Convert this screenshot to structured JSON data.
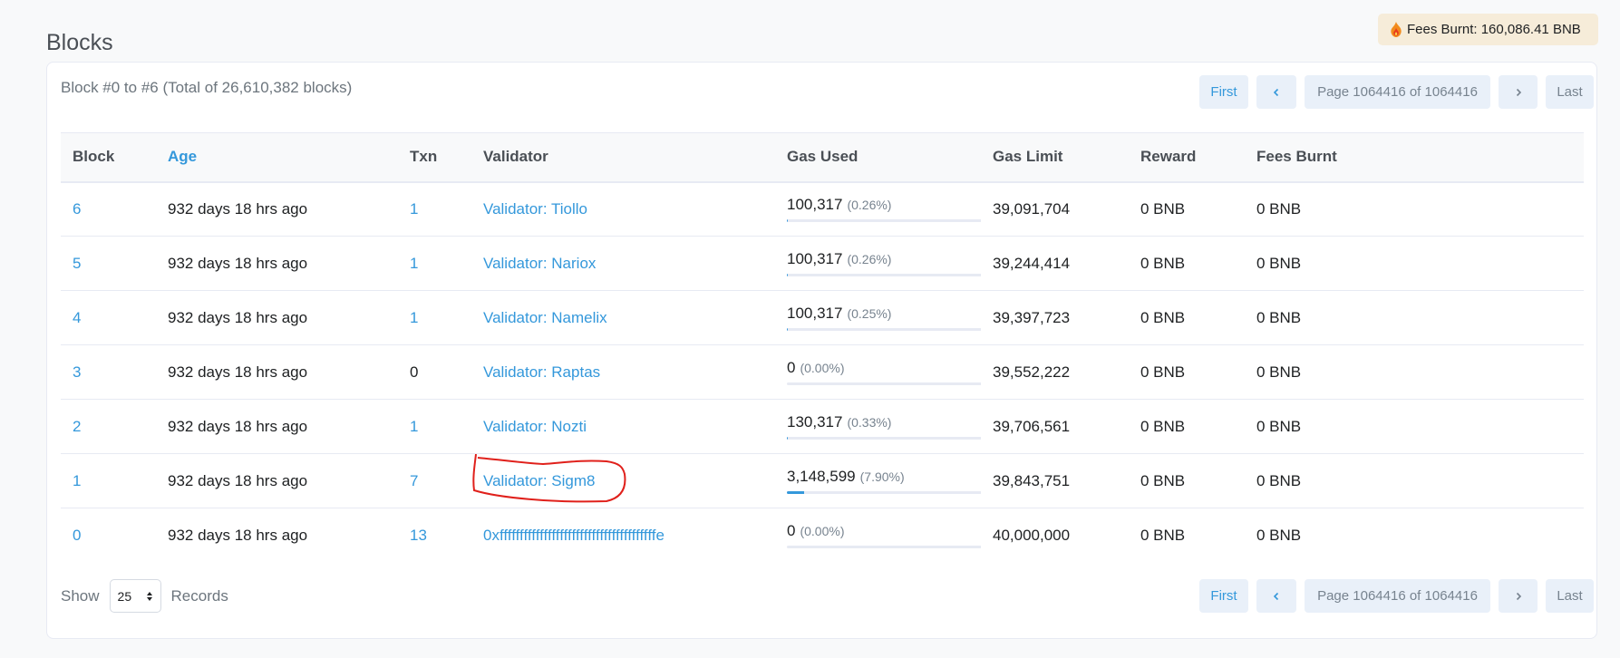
{
  "header": {
    "title": "Blocks",
    "fees_burnt_label": "Fees Burnt: 160,086.41 BNB",
    "fees_icon": "flame-icon"
  },
  "summary": "Block #0 to #6 (Total of 26,610,382 blocks)",
  "pagination": {
    "first": "First",
    "last": "Last",
    "page_info": "Page 1064416 of 1064416",
    "prev_icon": "chevron-left-icon",
    "next_icon": "chevron-right-icon"
  },
  "table": {
    "columns": [
      "Block",
      "Age",
      "Txn",
      "Validator",
      "Gas Used",
      "Gas Limit",
      "Reward",
      "Fees Burnt"
    ],
    "rows": [
      {
        "block": "6",
        "age": "932 days 18 hrs ago",
        "txn": "1",
        "validator": "Validator: Tiollo",
        "gas_used": "100,317",
        "gas_pct": "(0.26%)",
        "gas_fraction": 0.0026,
        "gas_limit": "39,091,704",
        "reward": "0 BNB",
        "fees_burnt": "0 BNB"
      },
      {
        "block": "5",
        "age": "932 days 18 hrs ago",
        "txn": "1",
        "validator": "Validator: Nariox",
        "gas_used": "100,317",
        "gas_pct": "(0.26%)",
        "gas_fraction": 0.0026,
        "gas_limit": "39,244,414",
        "reward": "0 BNB",
        "fees_burnt": "0 BNB"
      },
      {
        "block": "4",
        "age": "932 days 18 hrs ago",
        "txn": "1",
        "validator": "Validator: Namelix",
        "gas_used": "100,317",
        "gas_pct": "(0.25%)",
        "gas_fraction": 0.0025,
        "gas_limit": "39,397,723",
        "reward": "0 BNB",
        "fees_burnt": "0 BNB"
      },
      {
        "block": "3",
        "age": "932 days 18 hrs ago",
        "txn": "0",
        "validator": "Validator: Raptas",
        "gas_used": "0",
        "gas_pct": "(0.00%)",
        "gas_fraction": 0,
        "gas_limit": "39,552,222",
        "reward": "0 BNB",
        "fees_burnt": "0 BNB"
      },
      {
        "block": "2",
        "age": "932 days 18 hrs ago",
        "txn": "1",
        "validator": "Validator: Nozti",
        "gas_used": "130,317",
        "gas_pct": "(0.33%)",
        "gas_fraction": 0.0033,
        "gas_limit": "39,706,561",
        "reward": "0 BNB",
        "fees_burnt": "0 BNB"
      },
      {
        "block": "1",
        "age": "932 days 18 hrs ago",
        "txn": "7",
        "validator": "Validator: Sigm8",
        "gas_used": "3,148,599",
        "gas_pct": "(7.90%)",
        "gas_fraction": 0.079,
        "gas_limit": "39,843,751",
        "reward": "0 BNB",
        "fees_burnt": "0 BNB",
        "highlighted": true
      },
      {
        "block": "0",
        "age": "932 days 18 hrs ago",
        "txn": "13",
        "validator": "0xfffffffffffffffffffffffffffffffffffffffe",
        "gas_used": "0",
        "gas_pct": "(0.00%)",
        "gas_fraction": 0,
        "gas_limit": "40,000,000",
        "reward": "0 BNB",
        "fees_burnt": "0 BNB"
      }
    ]
  },
  "footer": {
    "show_label": "Show",
    "records_value": "25",
    "records_label": "Records"
  },
  "colors": {
    "link": "#3498db",
    "annotation": "#e0201b",
    "badge_bg": "#f6ecd9"
  }
}
